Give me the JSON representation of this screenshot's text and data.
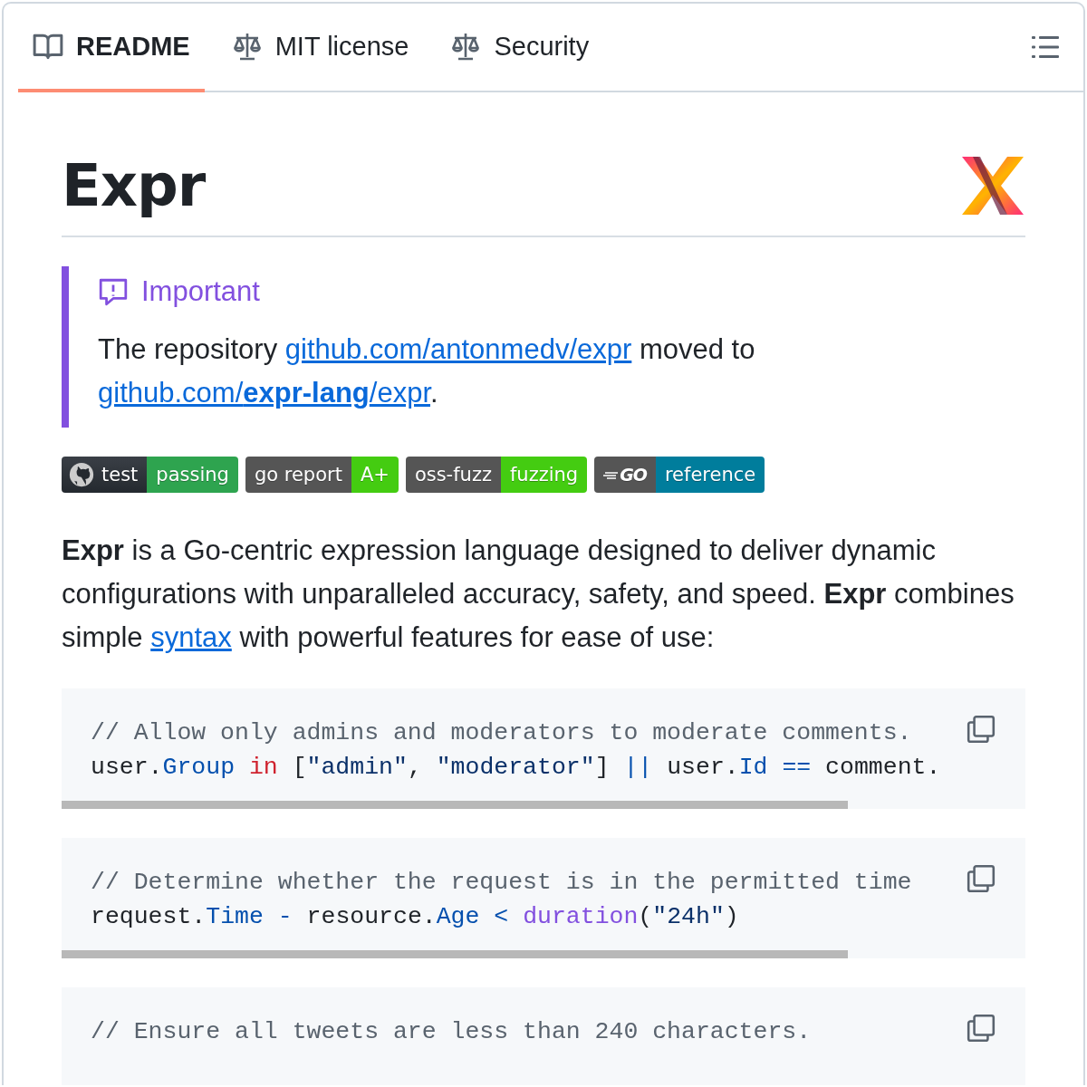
{
  "tabs": [
    {
      "label": "README",
      "kind": "book",
      "selected": true
    },
    {
      "label": "MIT license",
      "kind": "scale",
      "selected": false
    },
    {
      "label": "Security",
      "kind": "scale",
      "selected": false
    }
  ],
  "title": "Expr",
  "alert": {
    "title": "Important",
    "parts": [
      {
        "kind": "text",
        "text": "The repository "
      },
      {
        "kind": "link",
        "text": "github.com/antonmedv/expr"
      },
      {
        "kind": "text",
        "text": " moved to "
      },
      {
        "kind": "link",
        "text": "github.com/**expr-lang**/expr"
      },
      {
        "kind": "text",
        "text": "."
      }
    ]
  },
  "badges": [
    {
      "kind": "github",
      "label": "test",
      "value": "passing",
      "color": "#2ea44f"
    },
    {
      "kind": "plain",
      "label": "go report",
      "value": "A+",
      "color": "#44cc11"
    },
    {
      "kind": "plain",
      "label": "oss-fuzz",
      "value": "fuzzing",
      "color": "#44cc11"
    },
    {
      "kind": "go",
      "label": "GO",
      "value": "reference",
      "color": "#007d9c"
    }
  ],
  "intro": [
    {
      "kind": "text",
      "text": "**Expr** is a Go-centric expression language designed to deliver dynamic configurations with unparalleled accuracy, safety, and speed. **Expr** combines simple "
    },
    {
      "kind": "link",
      "text": "syntax"
    },
    {
      "kind": "text",
      "text": " with powerful features for ease of use:"
    }
  ],
  "code_blocks": [
    {
      "lines": [
        [
          {
            "kind": "comment",
            "text": "// Allow only admins and moderators to moderate comments."
          }
        ],
        [
          {
            "kind": "plain",
            "text": "user."
          },
          {
            "kind": "prop",
            "text": "Group"
          },
          {
            "kind": "keyword",
            "text": " in"
          },
          {
            "kind": "plain",
            "text": " ["
          },
          {
            "kind": "string",
            "text": "\"admin\""
          },
          {
            "kind": "plain",
            "text": ", "
          },
          {
            "kind": "string",
            "text": "\"moderator\""
          },
          {
            "kind": "plain",
            "text": "] "
          },
          {
            "kind": "operator",
            "text": "||"
          },
          {
            "kind": "plain",
            "text": " user."
          },
          {
            "kind": "prop",
            "text": "Id"
          },
          {
            "kind": "operator",
            "text": " =="
          },
          {
            "kind": "plain",
            "text": " comment."
          }
        ]
      ]
    },
    {
      "lines": [
        [
          {
            "kind": "comment",
            "text": "// Determine whether the request is in the permitted time"
          }
        ],
        [
          {
            "kind": "plain",
            "text": "request."
          },
          {
            "kind": "prop",
            "text": "Time"
          },
          {
            "kind": "operator",
            "text": " -"
          },
          {
            "kind": "plain",
            "text": " resource."
          },
          {
            "kind": "prop",
            "text": "Age"
          },
          {
            "kind": "operator",
            "text": " <"
          },
          {
            "kind": "func",
            "text": " duration"
          },
          {
            "kind": "plain",
            "text": "("
          },
          {
            "kind": "string",
            "text": "\"24h\""
          },
          {
            "kind": "plain",
            "text": ")"
          }
        ]
      ]
    },
    {
      "lines": [
        [
          {
            "kind": "comment",
            "text": "// Ensure all tweets are less than 240 characters."
          }
        ]
      ]
    }
  ]
}
